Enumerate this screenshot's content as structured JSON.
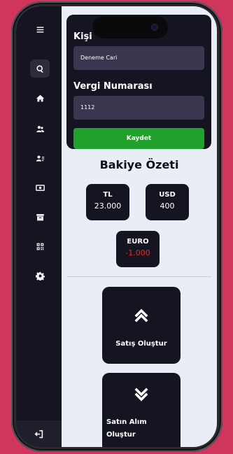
{
  "form": {
    "kisi_label": "Kişi",
    "kisi_value": "Deneme Cari",
    "vergi_label": "Vergi Numarası",
    "vergi_value": "1112",
    "save_label": "Kaydet"
  },
  "summary": {
    "title": "Bakiye Özeti",
    "balances": [
      {
        "currency": "TL",
        "amount": "23.000"
      },
      {
        "currency": "USD",
        "amount": "400"
      },
      {
        "currency": "EURO",
        "amount": "-1.000"
      }
    ]
  },
  "actions": {
    "sale_label": "Satış Oluştur",
    "purchase_label_line1": "Satın Alım",
    "purchase_label_line2": "Oluştur"
  },
  "sidebar": {
    "icons": [
      "menu-icon",
      "search-icon",
      "home-icon",
      "users-icon",
      "contacts-icon",
      "money-icon",
      "archive-icon",
      "qrcode-icon",
      "settings-icon",
      "logout-icon"
    ]
  },
  "colors": {
    "sidebar_bg": "#151521",
    "save_button": "#21a12b",
    "negative_amount": "#e12a2a",
    "content_bg": "#e9edf6",
    "device_backdrop": "#d0355e"
  }
}
